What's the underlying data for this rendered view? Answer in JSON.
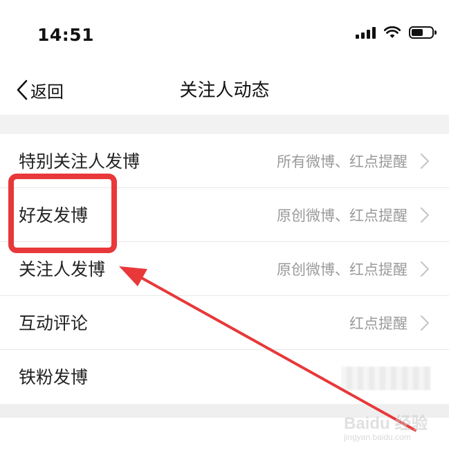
{
  "status_bar": {
    "time": "14:51"
  },
  "nav": {
    "back_label": "返回",
    "title": "关注人动态"
  },
  "rows": [
    {
      "title": "特别关注人发博",
      "value": "所有微博、红点提醒"
    },
    {
      "title": "好友发博",
      "value": "原创微博、红点提醒"
    },
    {
      "title": "关注人发博",
      "value": "原创微博、红点提醒"
    },
    {
      "title": "互动评论",
      "value": "红点提醒"
    },
    {
      "title": "铁粉发博",
      "value": ""
    }
  ],
  "annotation": {
    "highlight_color": "#e8383a",
    "arrow_color": "#e8383a"
  },
  "watermark": {
    "main": "Baidu 经验",
    "sub": "jingyan.baidu.com"
  }
}
